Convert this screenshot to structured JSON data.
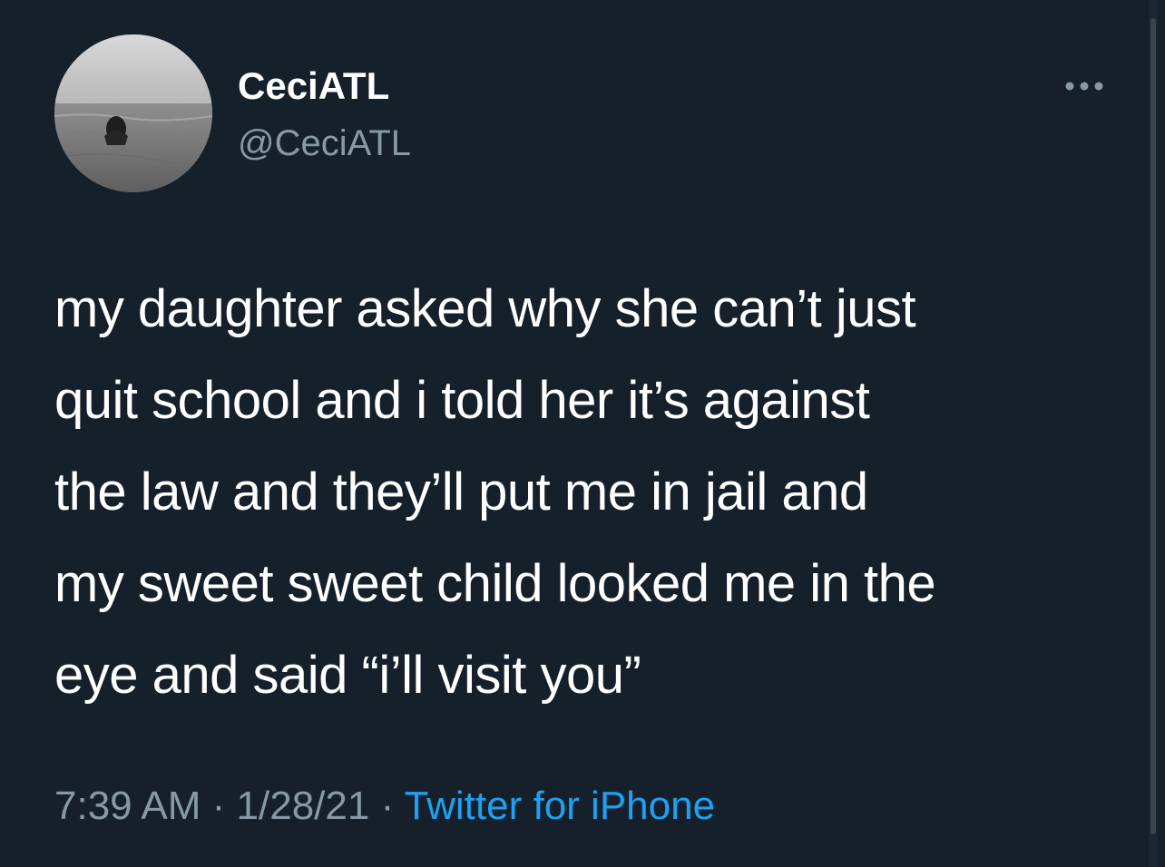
{
  "user": {
    "display_name": "CeciATL",
    "handle": "@CeciATL",
    "avatar_icon": "avatar-photo"
  },
  "more_icon": "more-horizontal-icon",
  "tweet": {
    "lines": [
      "my daughter asked why she can’t just",
      "quit school and i told her it’s against",
      "the law and they’ll put me in jail and",
      "my sweet sweet child looked me in the",
      "eye and said “i’ll visit you”"
    ]
  },
  "meta": {
    "time": "7:39 AM",
    "separator": " · ",
    "date": "1/28/21",
    "source": "Twitter for iPhone"
  },
  "colors": {
    "background": "#15202b",
    "text": "#ffffff",
    "secondary": "#8899a6",
    "link": "#1da1f2"
  }
}
